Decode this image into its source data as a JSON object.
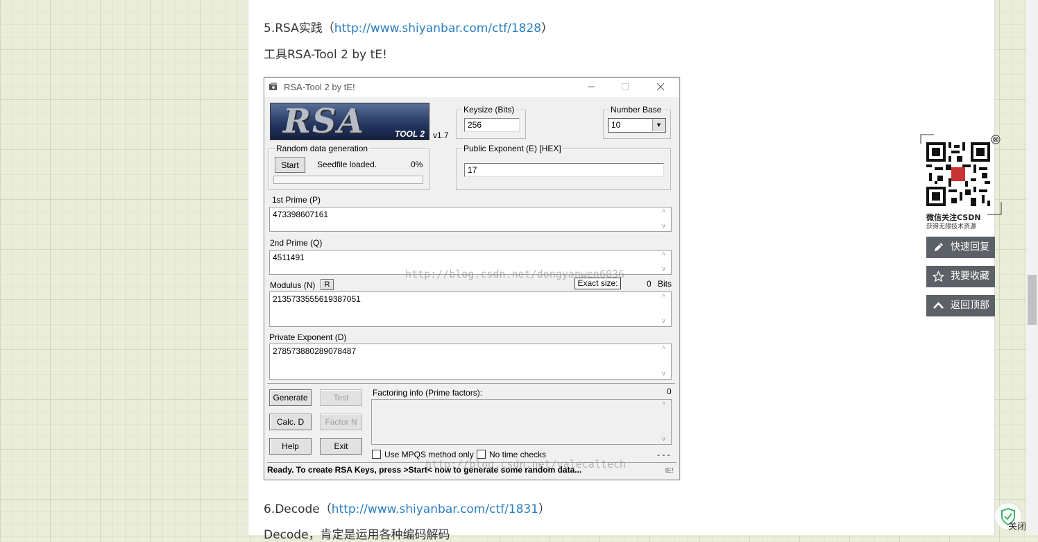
{
  "article": {
    "line1_prefix": "5.RSA实践（",
    "line1_link": "http://www.shiyanbar.com/ctf/1828",
    "line1_suffix": "）",
    "line2": "工具RSA-Tool 2 by tE!",
    "line3_prefix": "6.Decode（",
    "line3_link": "http://www.shiyanbar.com/ctf/1831",
    "line3_suffix": "）",
    "line4": "Decode，肯定是运用各种编码解码"
  },
  "rsa_tool": {
    "title": "RSA-Tool 2 by tE!",
    "logo_text": "RSA",
    "logo_sub": "TOOL 2",
    "version": "v1.7",
    "keysize_label": "Keysize (Bits)",
    "keysize_value": "256",
    "number_base_label": "Number Base",
    "number_base_value": "10",
    "random_label": "Random data generation",
    "start_button": "Start",
    "seedfile_text": "Seedfile loaded.",
    "progress_text": "0%",
    "pub_exp_label": "Public Exponent (E) [HEX]",
    "pub_exp_value": "17",
    "p_label": "1st Prime (P)",
    "p_value": "473398607161",
    "q_label": "2nd Prime (Q)",
    "q_value": "4511491",
    "n_label": "Modulus (N)",
    "n_r_button": "R",
    "exact_size_label": "Exact size:",
    "exact_size_value": "0",
    "bits_label": "Bits",
    "n_value": "2135733555619387051",
    "d_label": "Private Exponent (D)",
    "d_value": "278573880289078487",
    "generate_button": "Generate",
    "test_button": "Test",
    "calcd_button": "Calc. D",
    "factorn_button": "Factor N",
    "help_button": "Help",
    "exit_button": "Exit",
    "factoring_label": "Factoring info (Prime factors):",
    "factoring_count": "0",
    "mpqs_label": "Use MPQS method only",
    "notime_label": "No time checks",
    "dashes": "- - -",
    "status_text": "Ready. To create RSA Keys, press >Start< now to generate some random data...",
    "status_tag": "tE!",
    "watermark1": "http://blog.csdn.net/dongyanwen6036",
    "watermark2": "http://blog.csdn.net/valecaltech"
  },
  "sidebar": {
    "qr_caption1": "微信关注CSDN",
    "qr_caption2": "获得无限技术资源",
    "quick_reply": "快速回复",
    "favorite": "我要收藏",
    "back_top": "返回顶部",
    "close": "关闭"
  },
  "colors": {
    "link": "#2a7ec2",
    "side_button": "#5b6166",
    "page_bg": "#eaedd9"
  }
}
